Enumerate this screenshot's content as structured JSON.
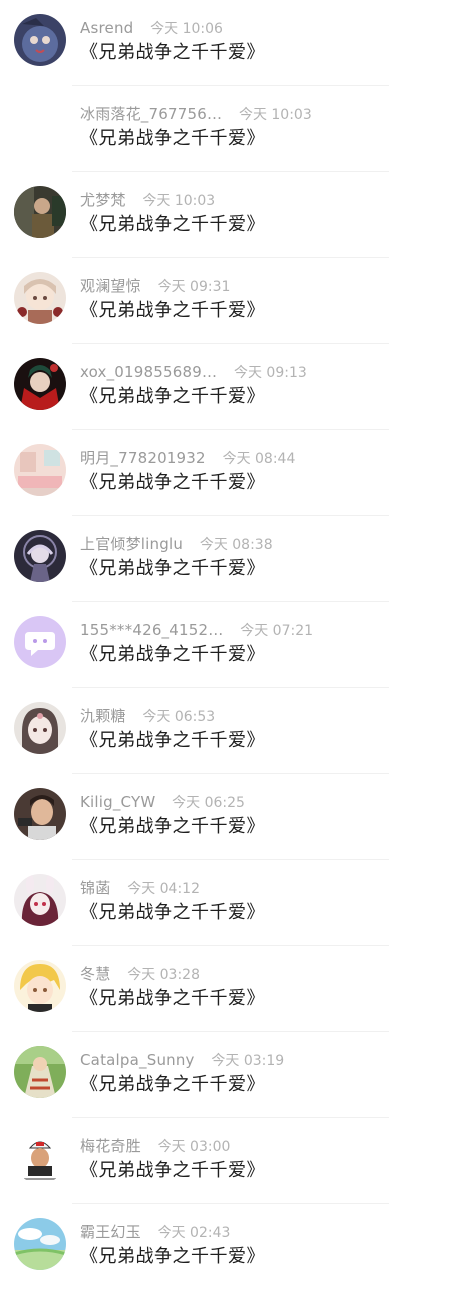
{
  "comments": [
    {
      "name": "Asrend",
      "time": "今天 10:06",
      "text": "《兄弟战争之千千爱》",
      "avatar_icon": "dark-blue-character-avatar"
    },
    {
      "name": "冰雨落花_767756…",
      "time": "今天 10:03",
      "text": "《兄弟战争之千千爱》",
      "avatar_icon": "none"
    },
    {
      "name": "尤梦梵",
      "time": "今天 10:03",
      "text": "《兄弟战争之千千爱》",
      "avatar_icon": "dark-scene-avatar"
    },
    {
      "name": "观澜望惊",
      "time": "今天 09:31",
      "text": "《兄弟战争之千千爱》",
      "avatar_icon": "anime-girl-avatar"
    },
    {
      "name": "xox_019855689…",
      "time": "今天 09:13",
      "text": "《兄弟战争之千千爱》",
      "avatar_icon": "red-green-character-avatar"
    },
    {
      "name": "明月_778201932",
      "time": "今天 08:44",
      "text": "《兄弟战争之千千爱》",
      "avatar_icon": "pink-room-avatar"
    },
    {
      "name": "上官倾梦linglu",
      "time": "今天 08:38",
      "text": "《兄弟战争之千千爱》",
      "avatar_icon": "dark-anime-avatar"
    },
    {
      "name": "155***426_4152…",
      "time": "今天 07:21",
      "text": "《兄弟战争之千千爱》",
      "avatar_icon": "default-chat-bubble-avatar"
    },
    {
      "name": "氿颗糖",
      "time": "今天 06:53",
      "text": "《兄弟战争之千千爱》",
      "avatar_icon": "sketch-girl-avatar"
    },
    {
      "name": "Kilig_CYW",
      "time": "今天 06:25",
      "text": "《兄弟战争之千千爱》",
      "avatar_icon": "photo-person-avatar"
    },
    {
      "name": "锦菡",
      "time": "今天 04:12",
      "text": "《兄弟战争之千千爱》",
      "avatar_icon": "bunny-girl-avatar"
    },
    {
      "name": "冬慧",
      "time": "今天 03:28",
      "text": "《兄弟战争之千千爱》",
      "avatar_icon": "blonde-character-avatar"
    },
    {
      "name": "Catalpa_Sunny",
      "time": "今天 03:19",
      "text": "《兄弟战争之千千爱》",
      "avatar_icon": "green-landscape-avatar"
    },
    {
      "name": "梅花奇胜",
      "time": "今天 03:00",
      "text": "《兄弟战争之千千爱》",
      "avatar_icon": "sticker-avatar"
    },
    {
      "name": "霸王幻玉",
      "time": "今天 02:43",
      "text": "《兄弟战争之千千爱》",
      "avatar_icon": "sky-landscape-avatar"
    }
  ]
}
